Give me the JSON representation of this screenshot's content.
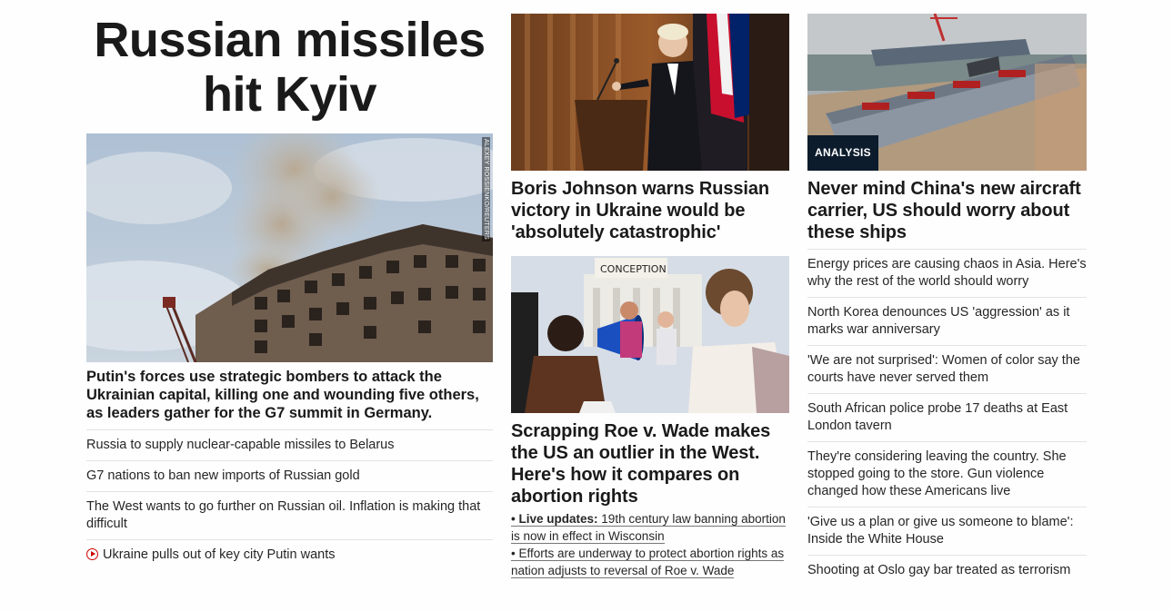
{
  "left": {
    "headline": "Russian missiles hit Kyiv",
    "hero_credit": "ALEXEY ROSSIENKO/REUTERS",
    "hero_caption": "Putin's forces use strategic bombers to attack the Ukrainian capital, killing one and wounding five others, as leaders gather for the G7 summit in Germany.",
    "stories": [
      "Russia to supply nuclear-capable missiles to Belarus",
      "G7 nations to ban new imports of Russian gold",
      "The West wants to go further on Russian oil. Inflation is making that difficult"
    ],
    "video_story": "Ukraine pulls out of key city Putin wants",
    "video_icon": "play-circle-icon"
  },
  "middle": {
    "card1_headline": "Boris Johnson warns Russian victory in Ukraine would be 'absolutely catastrophic'",
    "card2_sign": "CONCEPTION",
    "card2_headline": "Scrapping Roe v. Wade makes the US an outlier in the West. Here's how it compares on abortion rights",
    "bullet": "•",
    "live_label": "Live updates:",
    "live_text": "19th century law banning abortion is now in effect in Wisconsin",
    "link2": "Efforts are underway to protect abortion rights as nation adjusts to reversal of Roe v. Wade"
  },
  "right": {
    "badge": "ANALYSIS",
    "headline": "Never mind China's new aircraft carrier, US should worry about these ships",
    "stories": [
      "Energy prices are causing chaos in Asia. Here's why the rest of the world should worry",
      "North Korea denounces US 'aggression' as it marks war anniversary",
      "'We are not surprised': Women of color say the courts have never served them",
      "South African police probe 17 deaths at East London tavern",
      "They're considering leaving the country. She stopped going to the store. Gun violence changed how these Americans live",
      "'Give us a plan or give us someone to blame': Inside the White House",
      "Shooting at Oslo gay bar treated as terrorism"
    ]
  },
  "colors": {
    "accent_red": "#cc0000",
    "badge_bg": "#0c1c2c",
    "text": "#1a1a1a"
  }
}
